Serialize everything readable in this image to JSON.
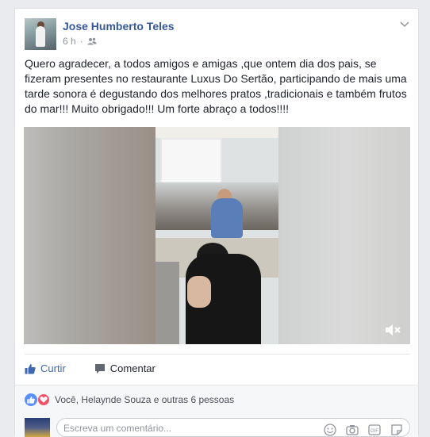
{
  "post": {
    "author": "Jose Humberto Teles",
    "time": "6 h",
    "privacy_icon": "friends-icon",
    "text_lines": [
      "Quero agradecer, a todos amigos e amigas ,que ontem dia dos pais, se",
      "fizeram presentes no restaurante Luxus Do Sertão, participando de mais uma",
      "tarde sonora é degustando dos melhores pratos ,tradicionais e também frutos",
      "do mar!!! Muito obrigado!!! Um forte abraço a todos!!!!"
    ]
  },
  "actions": {
    "like_label": "Curtir",
    "comment_label": "Comentar"
  },
  "reactions": {
    "summary": "Você, Helaynde Souza e outras 6 pessoas"
  },
  "comment_box": {
    "placeholder": "Escreva um comentário..."
  },
  "colors": {
    "link_blue": "#365899",
    "like_blue": "#4267b2",
    "love_red": "#f25268"
  }
}
